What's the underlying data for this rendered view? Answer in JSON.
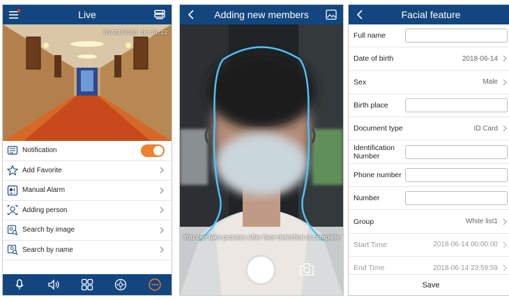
{
  "screen1": {
    "title": "Live",
    "timestamp": "05/23/2018 16:16:22",
    "menu": [
      {
        "label": "Notification",
        "icon": "notification-icon",
        "control": "toggle",
        "toggle_on": true
      },
      {
        "label": "Add Favorite",
        "icon": "star-icon",
        "control": "chevron"
      },
      {
        "label": "Manual Alarm",
        "icon": "alarm-icon",
        "control": "chevron"
      },
      {
        "label": "Adding person",
        "icon": "add-person-icon",
        "control": "chevron"
      },
      {
        "label": "Search by image",
        "icon": "image-search-icon",
        "control": "chevron"
      },
      {
        "label": "Search by name",
        "icon": "name-search-icon",
        "control": "chevron"
      }
    ],
    "bottom_icons": [
      "microphone-icon",
      "speaker-icon",
      "grid-icon",
      "ptz-icon",
      "more-icon"
    ],
    "colors": {
      "navbar": "#13467f",
      "toggle_on": "#f0802b"
    }
  },
  "screen2": {
    "title": "Adding new members",
    "tip": "You can take pictures after face detection is complete"
  },
  "screen3": {
    "title": "Facial feature",
    "rows": [
      {
        "label": "Full name",
        "type": "input",
        "value": ""
      },
      {
        "label": "Date of birth",
        "type": "select",
        "value": "2018-06-14"
      },
      {
        "label": "Sex",
        "type": "select",
        "value": "Male"
      },
      {
        "label": "Birth place",
        "type": "input",
        "value": ""
      },
      {
        "label": "Document type",
        "type": "select",
        "value": "ID Card"
      },
      {
        "label": "Identification Number",
        "type": "input",
        "value": ""
      },
      {
        "label": "Phone number",
        "type": "input",
        "value": ""
      },
      {
        "label": "Number",
        "type": "input",
        "value": ""
      },
      {
        "label": "Group",
        "type": "select",
        "value": "White list1"
      },
      {
        "label": "Start Time",
        "type": "select",
        "value": "2018-06-14 00:00:00",
        "muted": true
      },
      {
        "label": "End Time",
        "type": "select",
        "value": "2018-06-14 23:59:59",
        "muted": true
      }
    ],
    "save_label": "Save"
  }
}
